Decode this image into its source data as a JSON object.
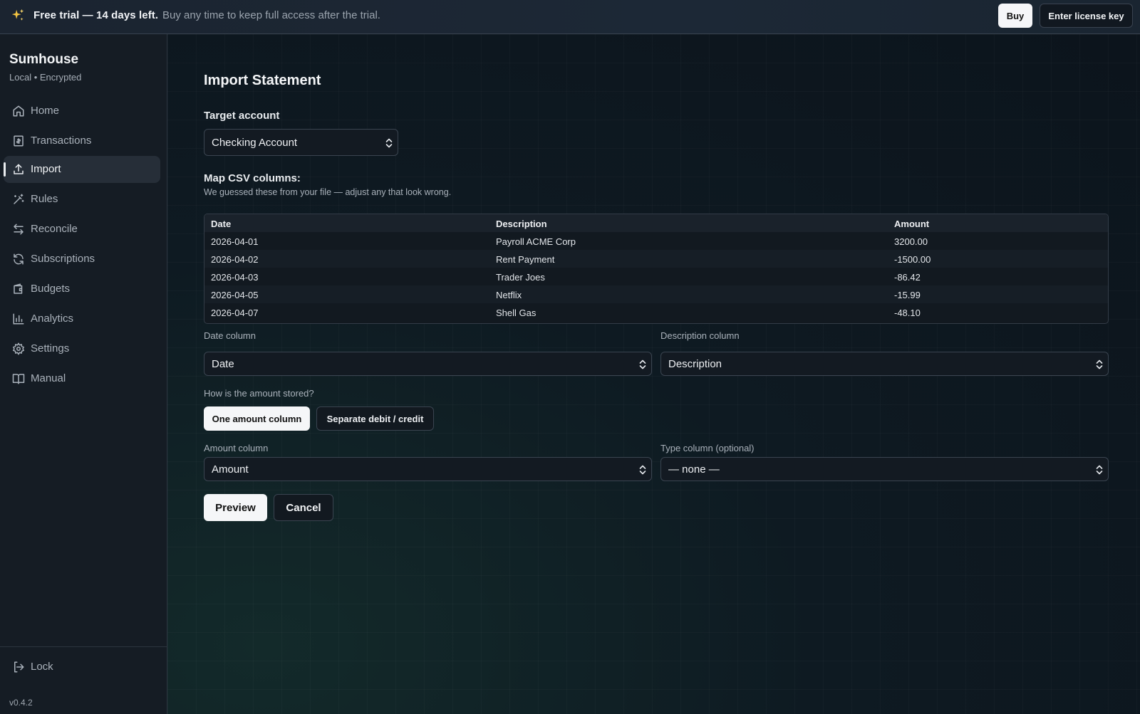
{
  "banner": {
    "title": "Free trial — 14 days left.",
    "subtitle": "Buy any time to keep full access after the trial.",
    "icon": "sparkles-icon",
    "buy_label": "Buy",
    "license_label": "Enter license key"
  },
  "sidebar": {
    "brand": "Sumhouse",
    "brand_sub": "Local • Encrypted",
    "items": [
      {
        "label": "Home",
        "icon": "home-icon"
      },
      {
        "label": "Transactions",
        "icon": "receipt-icon"
      },
      {
        "label": "Import",
        "icon": "upload-icon",
        "active": true
      },
      {
        "label": "Rules",
        "icon": "wand-icon"
      },
      {
        "label": "Reconcile",
        "icon": "swap-arrows-icon"
      },
      {
        "label": "Subscriptions",
        "icon": "refresh-icon"
      },
      {
        "label": "Budgets",
        "icon": "wallet-icon"
      },
      {
        "label": "Analytics",
        "icon": "bar-chart-icon"
      },
      {
        "label": "Settings",
        "icon": "gear-icon"
      },
      {
        "label": "Manual",
        "icon": "book-icon"
      }
    ],
    "lock_label": "Lock",
    "version": "v0.4.2"
  },
  "main": {
    "title": "Import Statement",
    "target_account": {
      "label": "Target account",
      "value": "Checking Account"
    },
    "map": {
      "title": "Map CSV columns:",
      "hint": "We guessed these from your file — adjust any that look wrong."
    },
    "table": {
      "headers": [
        "Date",
        "Description",
        "Amount"
      ],
      "rows": [
        [
          "2026-04-01",
          "Payroll ACME Corp",
          "3200.00"
        ],
        [
          "2026-04-02",
          "Rent Payment",
          "-1500.00"
        ],
        [
          "2026-04-03",
          "Trader Joes",
          "-86.42"
        ],
        [
          "2026-04-05",
          "Netflix",
          "-15.99"
        ],
        [
          "2026-04-07",
          "Shell Gas",
          "-48.10"
        ]
      ]
    },
    "date_column": {
      "label": "Date column",
      "value": "Date"
    },
    "description_column": {
      "label": "Description column",
      "value": "Description"
    },
    "amount_stored": {
      "question": "How is the amount stored?",
      "options": [
        "One amount column",
        "Separate debit / credit"
      ],
      "selected": "One amount column"
    },
    "amount_column": {
      "label": "Amount column",
      "value": "Amount"
    },
    "type_column": {
      "label": "Type column (optional)",
      "value": "— none —"
    },
    "preview_label": "Preview",
    "cancel_label": "Cancel"
  },
  "colors": {
    "background": "#0e151d",
    "sidebar": "#151c24",
    "primary_button": "#f5f6f8",
    "text": "#e6e9ee",
    "muted_text": "#aab2bb"
  }
}
